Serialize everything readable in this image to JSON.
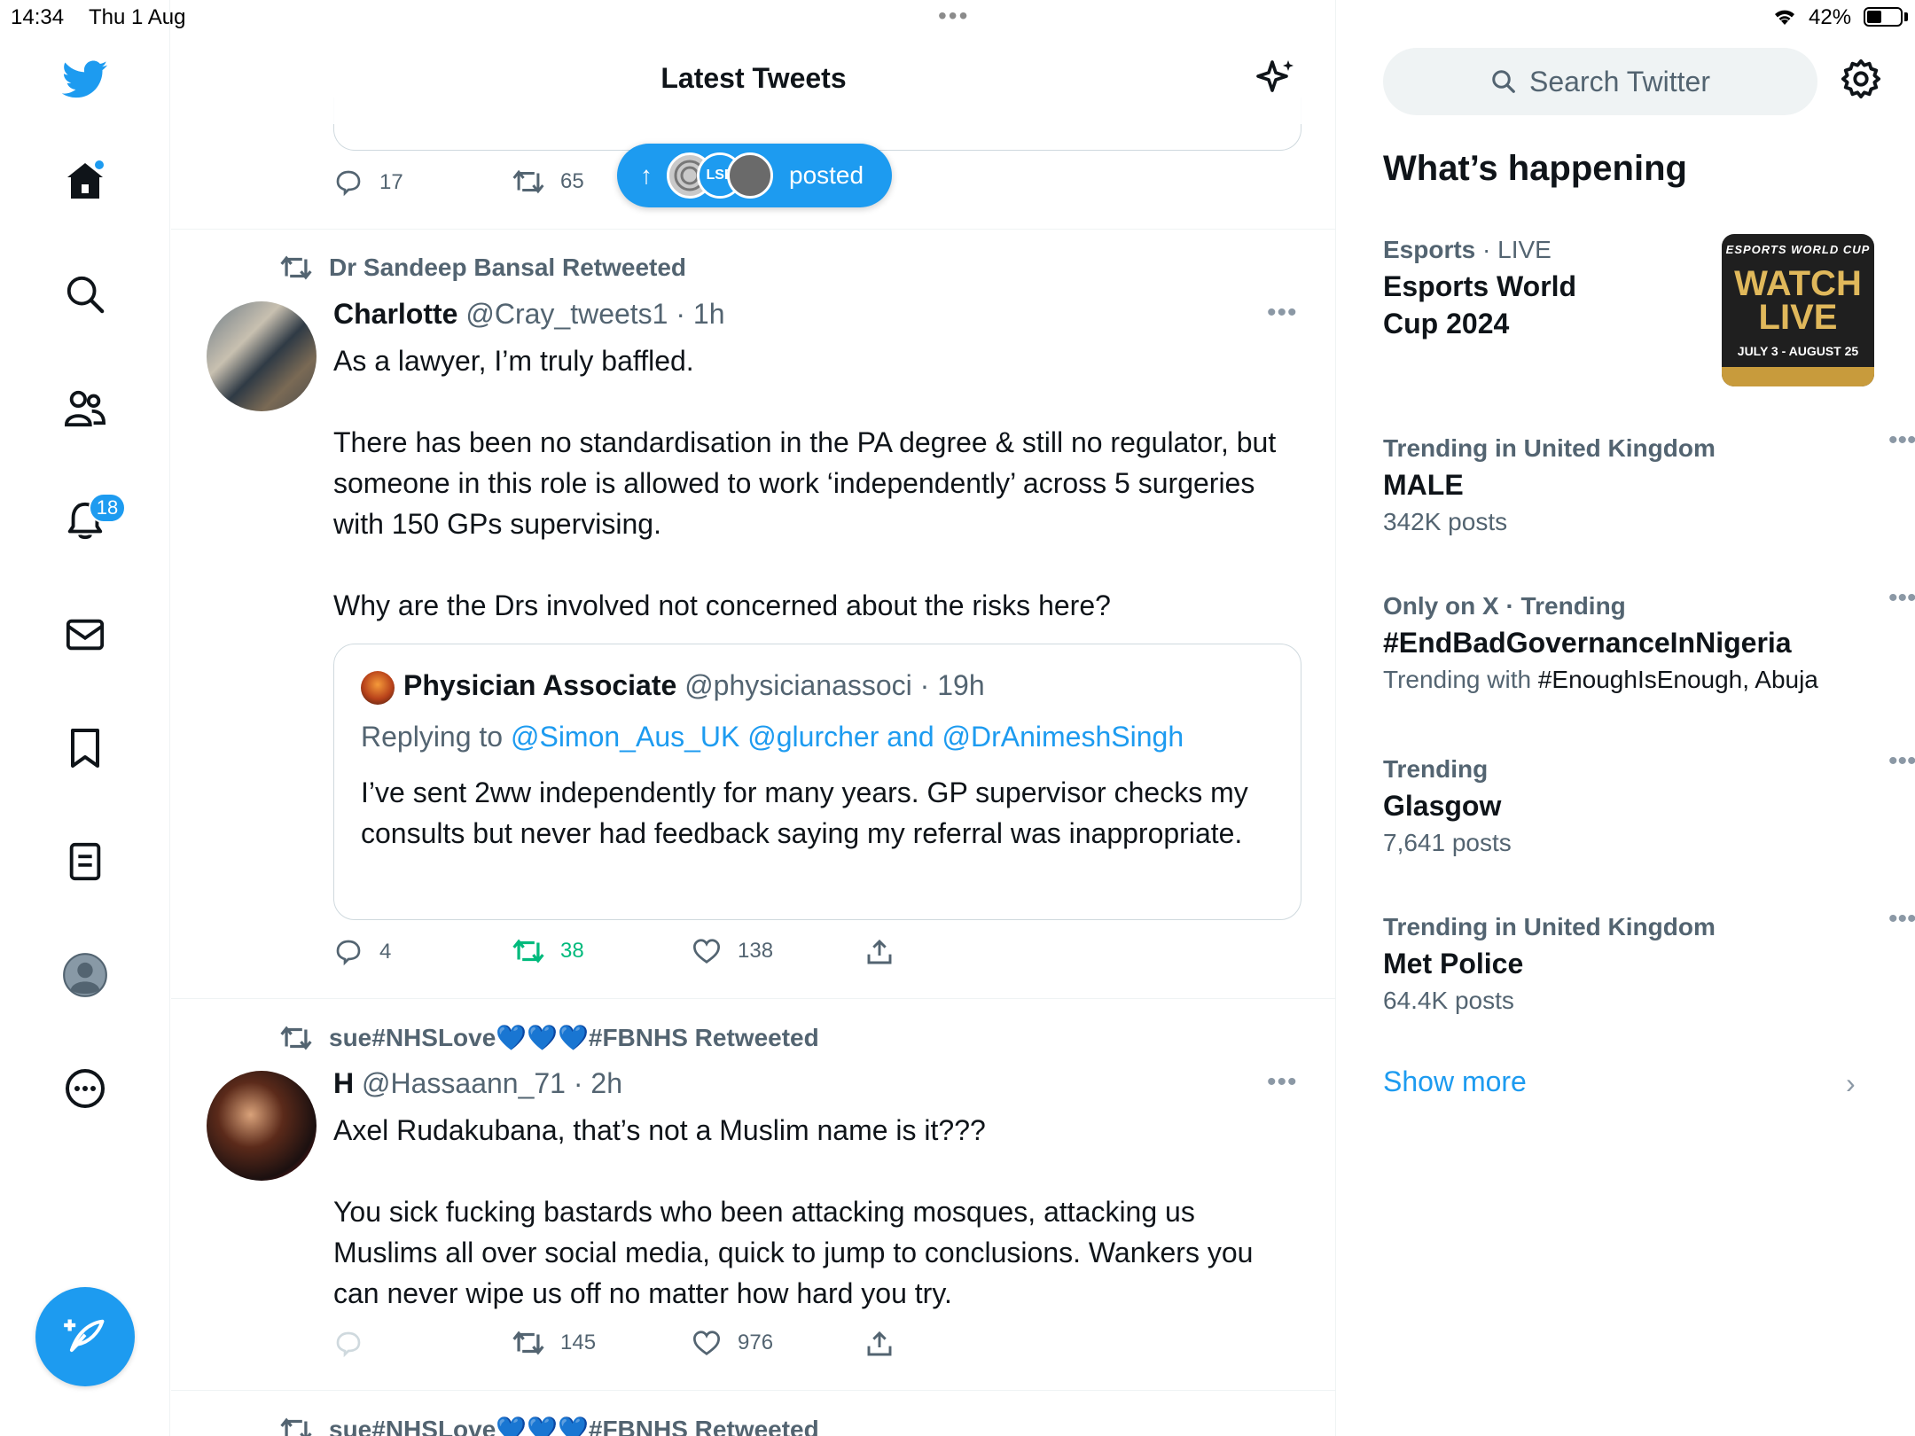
{
  "status_bar": {
    "time": "14:34",
    "date": "Thu 1 Aug",
    "battery": "42%"
  },
  "nav": {
    "notifications_badge": "18"
  },
  "timeline": {
    "title": "Latest Tweets",
    "top_partial": {
      "reply_count": "17",
      "retweet_count": "65",
      "posted_pill_label": "posted",
      "posted_pill_avatar_text": "LSE"
    },
    "tweets": [
      {
        "retweeted_by": "Dr Sandeep Bansal Retweeted",
        "name": "Charlotte",
        "handle": "@Cray_tweets1",
        "time": "· 1h",
        "text": "As a lawyer, I’m truly baffled.\n\nThere has been no standardisation in the PA degree & still no regulator, but someone in this role is allowed to work ‘independently’ across 5 surgeries with 150 GPs supervising.\n\nWhy are the Drs involved not concerned about the risks here?",
        "quote": {
          "name": "Physician Associate",
          "handle": "@physicianassoci",
          "time": "· 19h",
          "replying_prefix": "Replying to",
          "replying_to": "@Simon_Aus_UK @glurcher and @DrAnimeshSingh",
          "text": "I’ve sent 2ww independently for many years. GP supervisor checks my consults but never had feedback saying my referral was inappropriate."
        },
        "reply_count": "4",
        "retweet_count": "38",
        "like_count": "138"
      },
      {
        "retweeted_by": "sue#NHSLove💙💙💙#FBNHS Retweeted",
        "name": "H",
        "handle": "@Hassaann_71",
        "time": "· 2h",
        "text": "Axel Rudakubana, that’s not a Muslim name is it???\n\nYou sick fucking bastards who been attacking mosques, attacking us Muslims all over social media, quick to jump to conclusions. Wankers you can never wipe us off no matter how hard you try.",
        "reply_count": "",
        "retweet_count": "145",
        "like_count": "976"
      },
      {
        "retweeted_by": "sue#NHSLove💙💙💙#FBNHS Retweeted"
      }
    ]
  },
  "sidebar": {
    "search_placeholder": "Search Twitter",
    "title": "What’s happening",
    "esports": {
      "meta_category": "Esports",
      "meta_live": " · LIVE",
      "topic_line1": "Esports World",
      "topic_line2": "Cup 2024",
      "image_top": "ESPORTS WORLD CUP",
      "image_main1": "WATCH",
      "image_main2": "LIVE",
      "image_dates": "JULY 3 - AUGUST 25"
    },
    "trends": [
      {
        "meta": "Trending in United Kingdom",
        "topic": "MALE",
        "count": "342K posts"
      },
      {
        "meta": "Only on X · Trending",
        "topic": "#EndBadGovernanceInNigeria",
        "count_prefix": "Trending with ",
        "count_tags": "#EnoughIsEnough, Abuja"
      },
      {
        "meta": "Trending",
        "topic": "Glasgow",
        "count": "7,641 posts"
      },
      {
        "meta": "Trending in United Kingdom",
        "topic": "Met Police",
        "count": "64.4K posts"
      }
    ],
    "show_more": "Show more"
  },
  "colors": {
    "accent": "#1d9bf0",
    "retweet_green": "#00ba7c",
    "muted": "#536471"
  }
}
